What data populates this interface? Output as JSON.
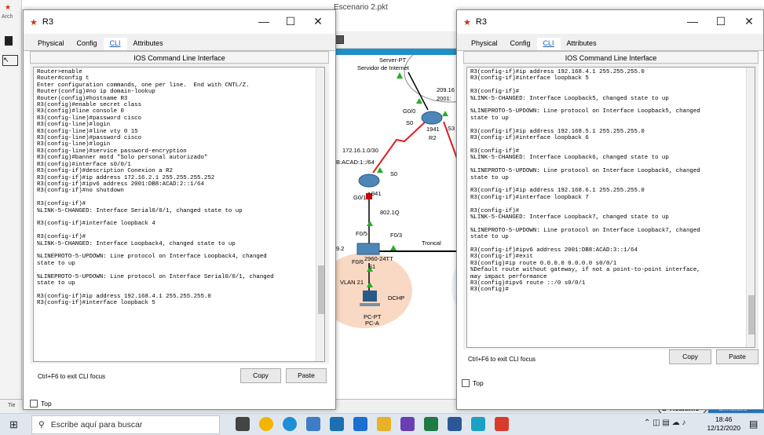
{
  "background": {
    "title": "Escenario 2.pkt",
    "menu_fragment": "Arch",
    "labels": {
      "server": "Server-PT",
      "server_name": "Servidor de Internet",
      "ip1": "209.16",
      "ip2": "2001:",
      "g00": "G0/0",
      "s0_top": "S0",
      "r2_model": "1941",
      "r2_name": "R2",
      "s3": "S3",
      "net1": "172.16.1.0/30",
      "net2": "B:ACAD:1::/64",
      "s0_mid": "S0",
      "g01": "G0/1",
      "r_model": "941",
      "dot1q": "802.1Q",
      "f05": "F0/5",
      "f03": "F0/3",
      "troncal": "Troncal",
      "ip_left": "9.2",
      "f06": "F0/6",
      "sw_model": "2960-24TT",
      "s1": "S1",
      "vlan": "VLAN 21",
      "dhcp": "DCHP",
      "pc_type": "PC-PT",
      "pc_name": "PC-A",
      "tie": "Tie"
    },
    "realtime": "Realtime",
    "simulation": "Simulatio"
  },
  "left_window": {
    "title": "R3",
    "tabs": [
      "Physical",
      "Config",
      "CLI",
      "Attributes"
    ],
    "active_tab": "CLI",
    "cli_header": "IOS Command Line Interface",
    "cli_text": "Router>enable\nRouter#config t\nEnter configuration commands, one per line.  End with CNTL/Z.\nRouter(config)#no ip domain-lookup\nRouter(config)#hostname R3\nR3(config)#enable secret class\nR3(config)#line console 0\nR3(config-line)#password cisco\nR3(config-line)#login\nR3(config-line)#line vty 0 15\nR3(config-line)#password cisco\nR3(config-line)#login\nR3(config-line)#service password-encryption\nR3(config)#banner motd \"Solo personal autorizado\"\nR3(config)#interface s0/0/1\nR3(config-if)#description Conexion a R2\nR3(config-if)#ip address 172.16.2.1 255.255.255.252\nR3(config-if)#ipv6 address 2001:DB8:ACAD:2::1/64\nR3(config-if)#no shutdown\n\nR3(config-if)#\n%LINK-5-CHANGED: Interface Serial0/0/1, changed state to up\n\nR3(config-if)#interface loopback 4\n\nR3(config-if)#\n%LINK-5-CHANGED: Interface Loopback4, changed state to up\n\n%LINEPROTO-5-UPDOWN: Line protocol on Interface Loopback4, changed\nstate to up\n\n%LINEPROTO-5-UPDOWN: Line protocol on Interface Serial0/0/1, changed\nstate to up\n\nR3(config-if)#ip address 192.168.4.1 255.255.255.0\nR3(config-if)#interface loopback 5",
    "focus_hint": "Ctrl+F6 to exit CLI focus",
    "copy_label": "Copy",
    "paste_label": "Paste",
    "top_label": "Top"
  },
  "right_window": {
    "title": "R3",
    "tabs": [
      "Physical",
      "Config",
      "CLI",
      "Attributes"
    ],
    "active_tab": "CLI",
    "cli_header": "IOS Command Line Interface",
    "cli_text": "R3(config-if)#ip address 192.168.4.1 255.255.255.0\nR3(config-if)#interface loopback 5\n\nR3(config-if)#\n%LINK-5-CHANGED: Interface Loopback5, changed state to up\n\n%LINEPROTO-5-UPDOWN: Line protocol on Interface Loopback5, changed\nstate to up\n\nR3(config-if)#ip address 192.168.5.1 255.255.255.0\nR3(config-if)#interface loopback 6\n\nR3(config-if)#\n%LINK-5-CHANGED: Interface Loopback6, changed state to up\n\n%LINEPROTO-5-UPDOWN: Line protocol on Interface Loopback6, changed\nstate to up\n\nR3(config-if)#ip address 192.168.6.1 255.255.255.0\nR3(config-if)#interface loopback 7\n\nR3(config-if)#\n%LINK-5-CHANGED: Interface Loopback7, changed state to up\n\n%LINEPROTO-5-UPDOWN: Line protocol on Interface Loopback7, changed\nstate to up\n\nR3(config-if)#ipv6 address 2001:DB8:ACAD:3::1/64\nR3(config-if)#exit\nR3(config)#ip route 0.0.0.0 0.0.0.0 s0/0/1\n%Default route without gateway, if not a point-to-point interface,\nmay impact performance\nR3(config)#ipv6 route ::/0 s0/0/1\nR3(config)#",
    "focus_hint": "Ctrl+F6 to exit CLI focus",
    "copy_label": "Copy",
    "paste_label": "Paste",
    "top_label": "Top"
  },
  "taskbar": {
    "search_placeholder": "Escribe aquí para buscar",
    "time": "18:46",
    "date": "12/12/2020"
  },
  "colors": {
    "accent": "#1a5fb4",
    "link_red": "#e02020",
    "link_green": "#22b022",
    "vlan_fill": "#f9d9c4"
  }
}
